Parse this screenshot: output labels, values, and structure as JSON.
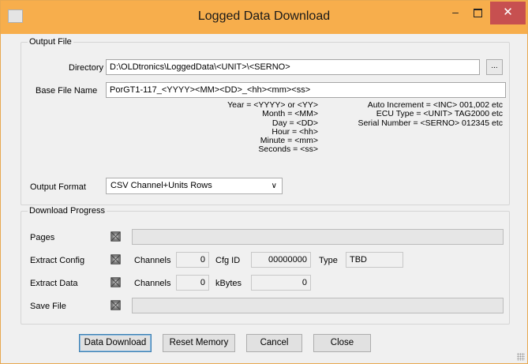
{
  "window": {
    "title": "Logged Data Download",
    "minimize_glyph": "–",
    "close_glyph": "✕",
    "colors": {
      "titlebar": "#f7ae4c",
      "close": "#c75050"
    }
  },
  "output_file": {
    "legend": "Output File",
    "directory_label": "Directory",
    "directory_value": "D:\\OLDtronics\\LoggedData\\<UNIT>\\<SERNO>",
    "browse_label": "...",
    "base_name_label": "Base File Name",
    "base_name_value": "PorGT1-117_<YYYY><MM><DD>_<hh><mm><ss>",
    "help_left": [
      "Year = <YYYY> or <YY>",
      "Month = <MM>",
      "Day = <DD>",
      "Hour = <hh>",
      "Minute = <mm>",
      "Seconds = <ss>"
    ],
    "help_right": [
      "Auto Increment = <INC> 001,002 etc",
      "ECU Type = <UNIT> TAG2000 etc",
      "Serial Number = <SERNO> 012345 etc"
    ],
    "format_label": "Output Format",
    "format_value": "CSV Channel+Units Rows"
  },
  "download_progress": {
    "legend": "Download Progress",
    "pages_label": "Pages",
    "extract_config_label": "Extract Config",
    "config_channels_label": "Channels",
    "config_channels_value": "0",
    "cfg_id_label": "Cfg ID",
    "cfg_id_value": "00000000",
    "type_label": "Type",
    "type_value": "TBD",
    "extract_data_label": "Extract Data",
    "data_channels_label": "Channels",
    "data_channels_value": "0",
    "kbytes_label": "kBytes",
    "kbytes_value": "0",
    "save_file_label": "Save File",
    "pages_progress": 0,
    "save_progress": 0
  },
  "buttons": {
    "data_download": "Data Download",
    "reset_memory": "Reset Memory",
    "cancel": "Cancel",
    "close": "Close"
  }
}
